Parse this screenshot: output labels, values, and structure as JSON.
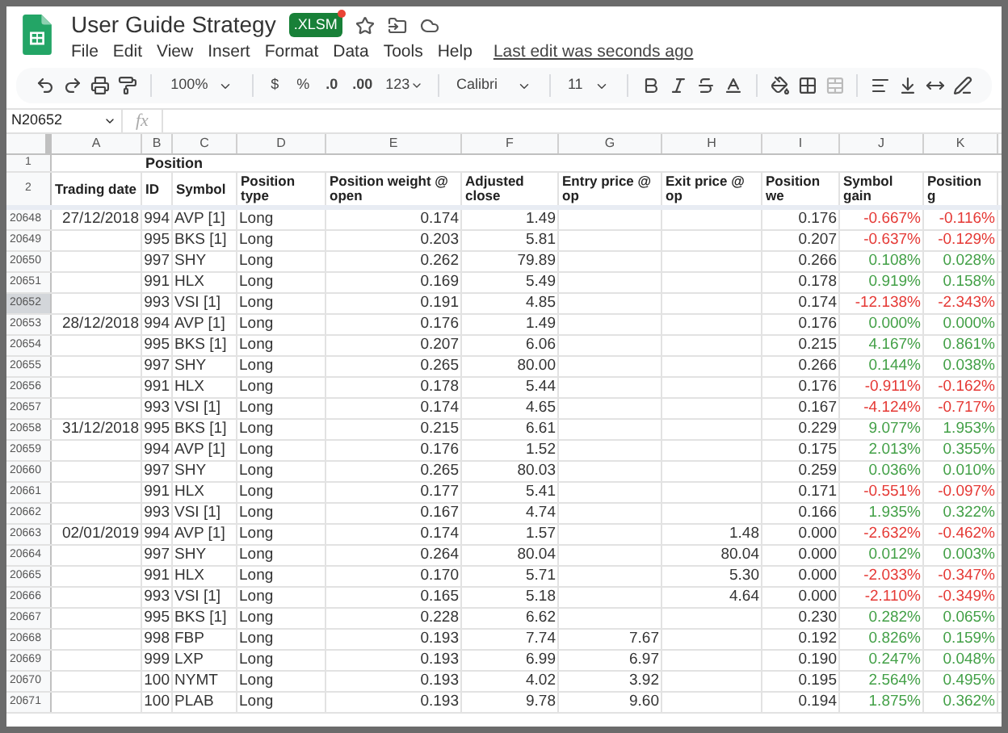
{
  "document": {
    "title": "User Guide Strategy",
    "badge": ".XLSM",
    "last_edit": "Last edit was seconds ago"
  },
  "menu": [
    "File",
    "Edit",
    "View",
    "Insert",
    "Format",
    "Data",
    "Tools",
    "Help"
  ],
  "toolbar": {
    "zoom": "100%",
    "currency": "$",
    "percent": "%",
    "decimal_less": ".0",
    "decimal_more": ".00",
    "number_format": "123",
    "font": "Calibri",
    "font_size": "11",
    "merge_disabled": true
  },
  "formula_bar": {
    "name_box": "N20652",
    "label": "fx"
  },
  "columns": [
    {
      "letter": "A",
      "header": "Trading date"
    },
    {
      "letter": "B",
      "header": "ID"
    },
    {
      "letter": "C",
      "header": "Symbol"
    },
    {
      "letter": "D",
      "header": "Position type"
    },
    {
      "letter": "E",
      "header": "Position weight @ open"
    },
    {
      "letter": "F",
      "header": "Adjusted close"
    },
    {
      "letter": "G",
      "header": "Entry price @ op"
    },
    {
      "letter": "H",
      "header": "Exit price @ op"
    },
    {
      "letter": "I",
      "header": "Position we"
    },
    {
      "letter": "J",
      "header": "Symbol gain"
    },
    {
      "letter": "K",
      "header": "Position g"
    }
  ],
  "title_row": {
    "row": "1",
    "label": "Position"
  },
  "header_row": {
    "row": "2"
  },
  "rows": [
    {
      "row": "20648",
      "selected": false,
      "color": "#e53935",
      "date": "27/12/2018",
      "id": "994",
      "symbol": "AVP [1]",
      "type": "Long",
      "weight_open": "0.174",
      "adj_close": "1.49",
      "weight": "0.176",
      "symbol_gain": "-0.667%",
      "position_gain": "-0.116%"
    },
    {
      "row": "20649",
      "selected": false,
      "color": "#e53935",
      "id": "995",
      "symbol": "BKS [1]",
      "type": "Long",
      "weight_open": "0.203",
      "adj_close": "5.81",
      "weight": "0.207",
      "symbol_gain": "-0.637%",
      "position_gain": "-0.129%"
    },
    {
      "row": "20650",
      "selected": false,
      "color": "#43a047",
      "id": "997",
      "symbol": "SHY",
      "type": "Long",
      "weight_open": "0.262",
      "adj_close": "79.89",
      "weight": "0.266",
      "symbol_gain": "0.108%",
      "position_gain": "0.028%"
    },
    {
      "row": "20651",
      "selected": false,
      "color": "#43a047",
      "id": "991",
      "symbol": "HLX",
      "type": "Long",
      "weight_open": "0.169",
      "adj_close": "5.49",
      "weight": "0.178",
      "symbol_gain": "0.919%",
      "position_gain": "0.158%"
    },
    {
      "row": "20652",
      "selected": true,
      "color": "#e53935",
      "id": "993",
      "symbol": "VSI [1]",
      "type": "Long",
      "weight_open": "0.191",
      "adj_close": "4.85",
      "weight": "0.174",
      "symbol_gain": "-12.138%",
      "position_gain": "-2.343%"
    },
    {
      "row": "20653",
      "selected": false,
      "color": "#43a047",
      "date": "28/12/2018",
      "id": "994",
      "symbol": "AVP [1]",
      "type": "Long",
      "weight_open": "0.176",
      "adj_close": "1.49",
      "weight": "0.176",
      "symbol_gain": "0.000%",
      "position_gain": "0.000%"
    },
    {
      "row": "20654",
      "selected": false,
      "color": "#43a047",
      "id": "995",
      "symbol": "BKS [1]",
      "type": "Long",
      "weight_open": "0.207",
      "adj_close": "6.06",
      "weight": "0.215",
      "symbol_gain": "4.167%",
      "position_gain": "0.861%"
    },
    {
      "row": "20655",
      "selected": false,
      "color": "#43a047",
      "id": "997",
      "symbol": "SHY",
      "type": "Long",
      "weight_open": "0.265",
      "adj_close": "80.00",
      "weight": "0.266",
      "symbol_gain": "0.144%",
      "position_gain": "0.038%"
    },
    {
      "row": "20656",
      "selected": false,
      "color": "#e53935",
      "id": "991",
      "symbol": "HLX",
      "type": "Long",
      "weight_open": "0.178",
      "adj_close": "5.44",
      "weight": "0.176",
      "symbol_gain": "-0.911%",
      "position_gain": "-0.162%"
    },
    {
      "row": "20657",
      "selected": false,
      "color": "#e53935",
      "id": "993",
      "symbol": "VSI [1]",
      "type": "Long",
      "weight_open": "0.174",
      "adj_close": "4.65",
      "weight": "0.167",
      "symbol_gain": "-4.124%",
      "position_gain": "-0.717%"
    },
    {
      "row": "20658",
      "selected": false,
      "color": "#43a047",
      "date": "31/12/2018",
      "id": "995",
      "symbol": "BKS [1]",
      "type": "Long",
      "weight_open": "0.215",
      "adj_close": "6.61",
      "weight": "0.229",
      "symbol_gain": "9.077%",
      "position_gain": "1.953%"
    },
    {
      "row": "20659",
      "selected": false,
      "color": "#43a047",
      "id": "994",
      "symbol": "AVP [1]",
      "type": "Long",
      "weight_open": "0.176",
      "adj_close": "1.52",
      "weight": "0.175",
      "symbol_gain": "2.013%",
      "position_gain": "0.355%"
    },
    {
      "row": "20660",
      "selected": false,
      "color": "#43a047",
      "id": "997",
      "symbol": "SHY",
      "type": "Long",
      "weight_open": "0.265",
      "adj_close": "80.03",
      "weight": "0.259",
      "symbol_gain": "0.036%",
      "position_gain": "0.010%"
    },
    {
      "row": "20661",
      "selected": false,
      "color": "#e53935",
      "id": "991",
      "symbol": "HLX",
      "type": "Long",
      "weight_open": "0.177",
      "adj_close": "5.41",
      "weight": "0.171",
      "symbol_gain": "-0.551%",
      "position_gain": "-0.097%"
    },
    {
      "row": "20662",
      "selected": false,
      "color": "#43a047",
      "id": "993",
      "symbol": "VSI [1]",
      "type": "Long",
      "weight_open": "0.167",
      "adj_close": "4.74",
      "weight": "0.166",
      "symbol_gain": "1.935%",
      "position_gain": "0.322%"
    },
    {
      "row": "20663",
      "selected": false,
      "color": "#e53935",
      "date": "02/01/2019",
      "id": "994",
      "symbol": "AVP [1]",
      "type": "Long",
      "weight_open": "0.174",
      "adj_close": "1.57",
      "exit_price": "1.48",
      "weight": "0.000",
      "symbol_gain": "-2.632%",
      "position_gain": "-0.462%"
    },
    {
      "row": "20664",
      "selected": false,
      "color": "#43a047",
      "id": "997",
      "symbol": "SHY",
      "type": "Long",
      "weight_open": "0.264",
      "adj_close": "80.04",
      "exit_price": "80.04",
      "weight": "0.000",
      "symbol_gain": "0.012%",
      "position_gain": "0.003%"
    },
    {
      "row": "20665",
      "selected": false,
      "color": "#e53935",
      "id": "991",
      "symbol": "HLX",
      "type": "Long",
      "weight_open": "0.170",
      "adj_close": "5.71",
      "exit_price": "5.30",
      "weight": "0.000",
      "symbol_gain": "-2.033%",
      "position_gain": "-0.347%"
    },
    {
      "row": "20666",
      "selected": false,
      "color": "#e53935",
      "id": "993",
      "symbol": "VSI [1]",
      "type": "Long",
      "weight_open": "0.165",
      "adj_close": "5.18",
      "exit_price": "4.64",
      "weight": "0.000",
      "symbol_gain": "-2.110%",
      "position_gain": "-0.349%"
    },
    {
      "row": "20667",
      "selected": false,
      "color": "#43a047",
      "id": "995",
      "symbol": "BKS [1]",
      "type": "Long",
      "weight_open": "0.228",
      "adj_close": "6.62",
      "weight": "0.230",
      "symbol_gain": "0.282%",
      "position_gain": "0.065%"
    },
    {
      "row": "20668",
      "selected": false,
      "color": "#43a047",
      "id": "998",
      "symbol": "FBP",
      "type": "Long",
      "weight_open": "0.193",
      "adj_close": "7.74",
      "entry_price": "7.67",
      "weight": "0.192",
      "symbol_gain": "0.826%",
      "position_gain": "0.159%"
    },
    {
      "row": "20669",
      "selected": false,
      "color": "#43a047",
      "id": "999",
      "symbol": "LXP",
      "type": "Long",
      "weight_open": "0.193",
      "adj_close": "6.99",
      "entry_price": "6.97",
      "weight": "0.190",
      "symbol_gain": "0.247%",
      "position_gain": "0.048%"
    },
    {
      "row": "20670",
      "selected": false,
      "color": "#43a047",
      "id": "100",
      "symbol": "NYMT",
      "type": "Long",
      "weight_open": "0.193",
      "adj_close": "4.02",
      "entry_price": "3.92",
      "weight": "0.195",
      "symbol_gain": "2.564%",
      "position_gain": "0.495%"
    },
    {
      "row": "20671",
      "selected": false,
      "color": "#43a047",
      "id": "100",
      "symbol": "PLAB",
      "type": "Long",
      "weight_open": "0.193",
      "adj_close": "9.78",
      "entry_price": "9.60",
      "weight": "0.194",
      "symbol_gain": "1.875%",
      "position_gain": "0.362%"
    }
  ]
}
